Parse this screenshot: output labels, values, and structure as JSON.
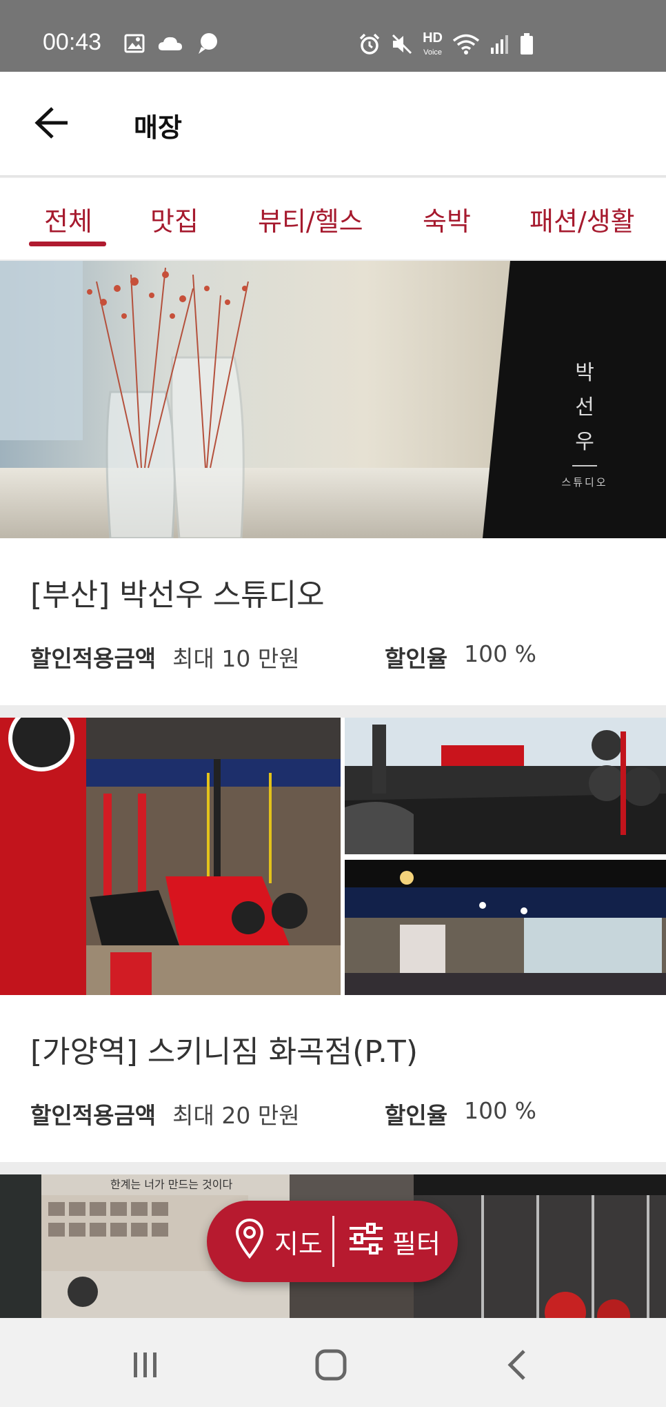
{
  "status_bar": {
    "time": "00:43",
    "left_icons": [
      "image-icon",
      "cloud-icon",
      "chat-bubble-icon"
    ],
    "right_icons": [
      "alarm-icon",
      "mute-icon",
      "hd-voice-icon",
      "wifi-icon",
      "signal-icon",
      "battery-icon"
    ],
    "hd_voice_label": "HD"
  },
  "header": {
    "title": "매장"
  },
  "tabs": [
    {
      "label": "전체",
      "selected": true
    },
    {
      "label": "맛집",
      "selected": false
    },
    {
      "label": "뷰티/헬스",
      "selected": false
    },
    {
      "label": "숙박",
      "selected": false
    },
    {
      "label": "패션/생활",
      "selected": false
    }
  ],
  "stores": [
    {
      "name": "[부산] 박선우 스튜디오",
      "discount_amount_label": "할인적용금액",
      "discount_amount_value": "최대 10 만원",
      "discount_rate_label": "할인율",
      "discount_rate_value": "100 %",
      "image_text": {
        "line1": "박",
        "line2": "선",
        "line3": "우",
        "sub": "스튜디오"
      }
    },
    {
      "name": "[가양역] 스키니짐 화곡점(P.T)",
      "discount_amount_label": "할인적용금액",
      "discount_amount_value": "최대 20 만원",
      "discount_rate_label": "할인율",
      "discount_rate_value": "100 %"
    },
    {
      "wall_text": "한계는 너가 만드는 것이다"
    }
  ],
  "fab": {
    "map_label": "지도",
    "filter_label": "필터"
  },
  "colors": {
    "accent": "#b71a2f",
    "tab_text": "#a61a2e",
    "status_bar": "#757575"
  }
}
